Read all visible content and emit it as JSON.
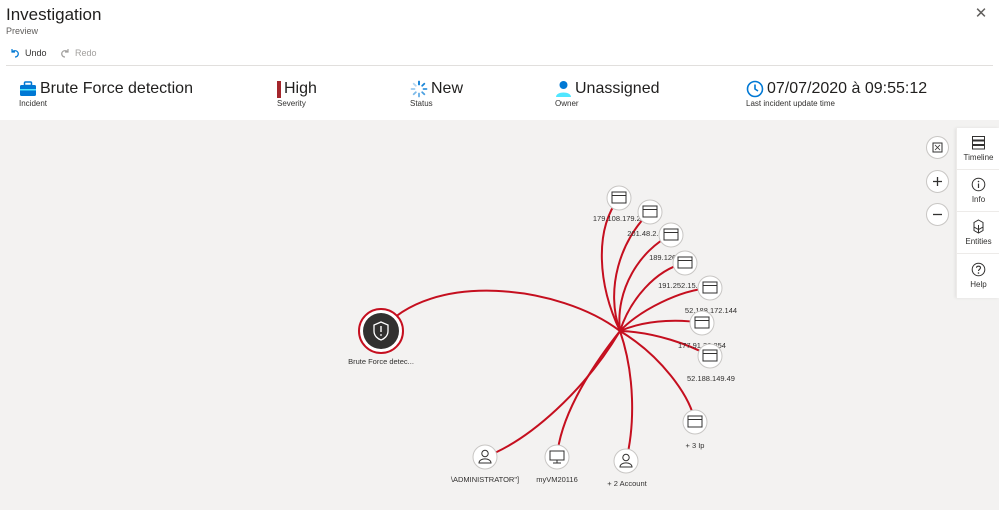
{
  "window": {
    "title": "Investigation",
    "subtitle": "Preview",
    "close_icon": "close-icon"
  },
  "toolbar": {
    "undo_label": "Undo",
    "redo_label": "Redo"
  },
  "summary": {
    "incident": {
      "value": "Brute Force detection",
      "label": "Incident",
      "icon": "briefcase-icon"
    },
    "severity": {
      "value": "High",
      "label": "Severity",
      "color": "#a4262c"
    },
    "status": {
      "value": "New",
      "label": "Status",
      "icon": "spinner-icon"
    },
    "owner": {
      "value": "Unassigned",
      "label": "Owner",
      "icon": "person-icon"
    },
    "update_time": {
      "value": "07/07/2020 à 09:55:12",
      "label": "Last incident update time",
      "icon": "clock-icon"
    }
  },
  "graph": {
    "edge_color": "#c50f1f",
    "alert_node": {
      "label": "Brute Force detec...",
      "icon": "shield-alert-icon"
    },
    "ip_nodes": [
      {
        "label": "179.108.179.2..."
      },
      {
        "label": "201.48.2..."
      },
      {
        "label": "189.126.2...4"
      },
      {
        "label": "191.252.15..."
      },
      {
        "label": "52.188.172.144"
      },
      {
        "label": "177.91.32.254"
      },
      {
        "label": "52.188.149.49"
      },
      {
        "label": "+ 3 Ip"
      }
    ],
    "bottom_nodes": [
      {
        "label": "\\ADMINISTRATOR\"]",
        "icon": "account-icon"
      },
      {
        "label": "myVM20116",
        "icon": "computer-icon"
      },
      {
        "label": "+ 2 Account",
        "icon": "account-icon"
      }
    ]
  },
  "side_panel": {
    "items": [
      {
        "label": "Timeline",
        "icon": "timeline-icon"
      },
      {
        "label": "Info",
        "icon": "info-icon"
      },
      {
        "label": "Entities",
        "icon": "entities-icon"
      },
      {
        "label": "Help",
        "icon": "help-icon"
      }
    ]
  },
  "controls": {
    "fit_icon": "fit-to-screen-icon",
    "zoom_in_icon": "zoom-in-icon",
    "zoom_out_icon": "zoom-out-icon"
  }
}
